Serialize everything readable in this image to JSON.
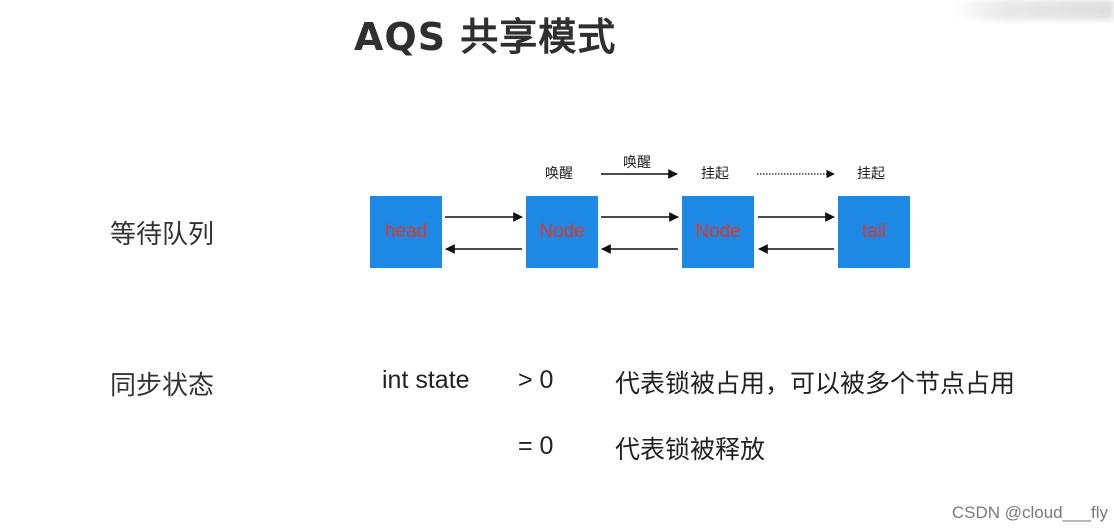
{
  "title": "AQS 共享模式",
  "queue": {
    "label": "等待队列",
    "nodes": [
      "head",
      "Node",
      "Node",
      "tail"
    ],
    "node_states": [
      "唤醒",
      "挂起",
      "挂起"
    ],
    "edge_label": "唤醒"
  },
  "sync": {
    "label": "同步状态",
    "var": "int state",
    "cases": [
      {
        "cond": "> 0",
        "desc": "代表锁被占用，可以被多个节点占用"
      },
      {
        "cond": "= 0",
        "desc": "代表锁被释放"
      }
    ]
  },
  "watermark": "CSDN @cloud___fly",
  "colors": {
    "node_fill": "#1e88e5",
    "node_text": "#e0392b"
  }
}
